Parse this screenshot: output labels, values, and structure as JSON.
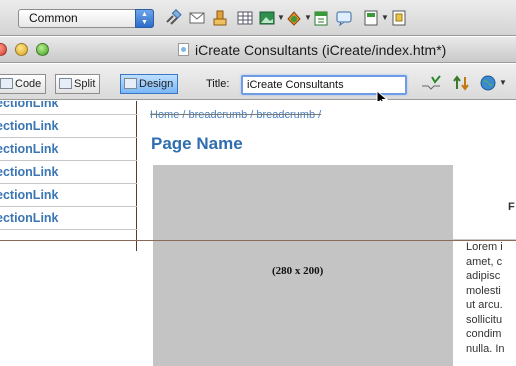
{
  "insert_bar": {
    "category": "Common",
    "icons": [
      "link-icon",
      "email-icon",
      "anchor-icon",
      "table-icon",
      "image-icon",
      "media-icon",
      "date-icon",
      "comment-icon",
      "template-icon",
      "tag-chooser-icon"
    ]
  },
  "window": {
    "title": "iCreate Consultants (iCreate/index.htm*)"
  },
  "doc_toolbar": {
    "code_label": "Code",
    "split_label": "Split",
    "design_label": "Design",
    "title_label": "Title:",
    "title_value": "iCreate Consultants"
  },
  "nav": {
    "items": [
      {
        "label": "ectionLink"
      },
      {
        "label": "ectionLink"
      },
      {
        "label": "ectionLink"
      },
      {
        "label": "ectionLink"
      },
      {
        "label": "ectionLink"
      },
      {
        "label": "ectionLink"
      }
    ]
  },
  "content": {
    "breadcrumb": "Home / breadcrumb / breadcrumb /",
    "page_name": "Page Name",
    "placeholder_label": "(280 x 200)",
    "right_cell_text": "F",
    "lorem_lines": [
      "Lorem i",
      "amet, c",
      "adipisc",
      "molesti",
      "ut arcu.",
      "sollicitu",
      "condim",
      "nulla. In"
    ]
  },
  "colors": {
    "link_blue": "#3a76b4",
    "page_name_blue": "#2f6eb0",
    "placeholder_gray": "#c4c4c4",
    "design_active": "#79b6f5"
  }
}
